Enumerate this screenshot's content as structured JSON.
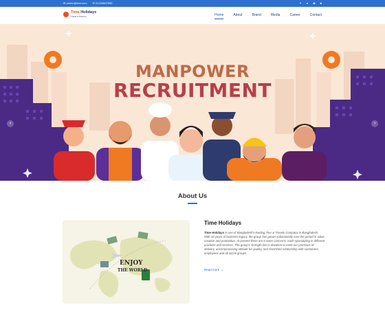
{
  "topbar": {
    "email": "admin@test.com",
    "phone": "01234567890",
    "social_icons": [
      "twitter-icon",
      "facebook-icon",
      "instagram-icon",
      "linkedin-icon"
    ]
  },
  "brand": {
    "name_part1": "Time",
    "name_part2": "Holidays",
    "tagline": "Travel & Tourism"
  },
  "nav": {
    "items": [
      {
        "label": "Home",
        "active": true
      },
      {
        "label": "About",
        "active": false
      },
      {
        "label": "Brand",
        "active": false
      },
      {
        "label": "Media",
        "active": false
      },
      {
        "label": "Career",
        "active": false
      },
      {
        "label": "Contact",
        "active": false
      }
    ]
  },
  "hero": {
    "line1": "MANPOWER",
    "line2": "RECRUITMENT",
    "prev": "‹",
    "next": "›"
  },
  "about": {
    "heading": "About Us",
    "title": "Time Holidays",
    "lead": "Time Holidays",
    "body": " is one of Bangladesh's leading Tour & Travels Company in Bangladesh. With 10 years of business legacy, the group has grown substantially over the period in value creation and production. At present there are 6 sister concerns, each specializing in different products and services. The group's strength lies in devotion to meet our promises of delivery, uncompromising attitude for quality, and cherished relationship with customers, employees and all social groups.",
    "read_more": "Read more →",
    "image_text1": "ENJOY",
    "image_text2": "THE WORLD"
  }
}
